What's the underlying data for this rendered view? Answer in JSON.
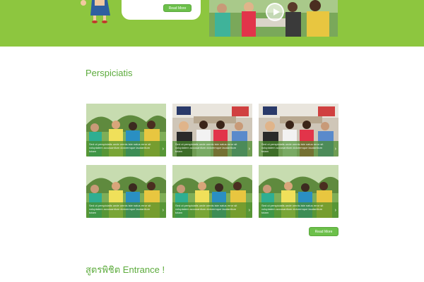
{
  "hero": {
    "read_more_label": "Read More"
  },
  "section": {
    "title": "Perspiciatis"
  },
  "tiles": [
    {
      "scene": "park",
      "caption": "Sed ut perspiciatis unde omnis iste natus error sit voluptatem accusantium doloremque laudantium totam"
    },
    {
      "scene": "indoor",
      "caption": "Sed ut perspiciatis unde omnis iste natus error sit voluptatem accusantium doloremque laudantium totam"
    },
    {
      "scene": "indoor",
      "caption": "Sed ut perspiciatis unde omnis iste natus error sit voluptatem accusantium doloremque laudantium totam"
    },
    {
      "scene": "park",
      "caption": "Sed ut perspiciatis unde omnis iste natus error sit voluptatem accusantium doloremque laudantium totam"
    },
    {
      "scene": "park",
      "caption": "Sed ut perspiciatis unde omnis iste natus error sit voluptatem accusantium doloremque laudantium totam"
    },
    {
      "scene": "park",
      "caption": "Sed ut perspiciatis unde omnis iste natus error sit voluptatem accusantium doloremque laudantium totam"
    }
  ],
  "more": {
    "read_more_label": "Read More"
  },
  "footer_section": {
    "title": "สูตรพิชิต Entrance !"
  },
  "colors": {
    "brand_green": "#8dc63f",
    "title_green": "#5cab3c",
    "button_green": "#6cc04a"
  },
  "icons": {
    "tile_arrow": "chevron-right-icon",
    "video": "play-icon"
  }
}
